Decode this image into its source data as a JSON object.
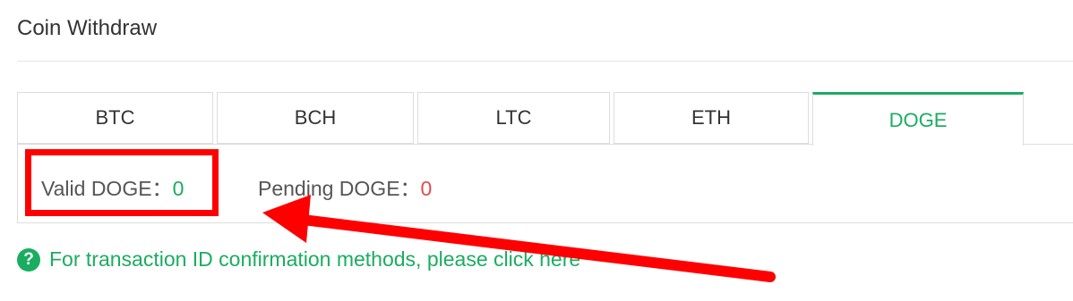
{
  "page": {
    "title": "Coin Withdraw"
  },
  "tabs": [
    {
      "label": "BTC",
      "active": false
    },
    {
      "label": "BCH",
      "active": false
    },
    {
      "label": "LTC",
      "active": false
    },
    {
      "label": "ETH",
      "active": false
    },
    {
      "label": "DOGE",
      "active": true
    }
  ],
  "balances": {
    "valid_label": "Valid DOGE：",
    "valid_value": "0",
    "pending_label": "Pending DOGE：",
    "pending_value": "0"
  },
  "help": {
    "icon": "question-circle-icon",
    "text": "For transaction ID confirmation methods, please click here"
  },
  "annotation": {
    "box_color": "#ff0000",
    "arrow_color": "#ff0000"
  },
  "colors": {
    "accent": "#1aad60",
    "pending_value": "#e64a4a"
  }
}
